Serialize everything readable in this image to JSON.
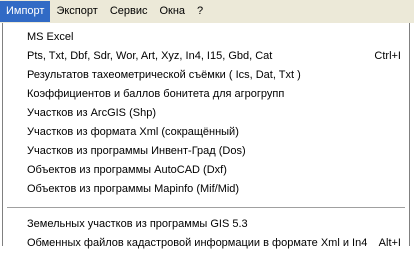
{
  "menubar": {
    "items": [
      {
        "label": "Импорт"
      },
      {
        "label": "Экспорт"
      },
      {
        "label": "Сервис"
      },
      {
        "label": "Окна"
      },
      {
        "label": "?"
      }
    ]
  },
  "dropdown": {
    "items": [
      {
        "label": "MS Excel",
        "shortcut": ""
      },
      {
        "label": "Pts, Txt, Dbf, Sdr, Wor, Art, Xyz, In4, I15, Gbd, Cat",
        "shortcut": "Ctrl+I"
      },
      {
        "label": "Результатов тахеометрической съёмки ( Ics, Dat, Txt )",
        "shortcut": ""
      },
      {
        "label": "Коэффициентов и баллов бонитета для агрогрупп",
        "shortcut": ""
      },
      {
        "label": "Участков из ArcGIS (Shp)",
        "shortcut": ""
      },
      {
        "label": "Участков из формата Xml (сокращённый)",
        "shortcut": ""
      },
      {
        "label": "Участков из программы Инвент-Град (Dos)",
        "shortcut": ""
      },
      {
        "label": "Объектов из программы AutoCAD (Dxf)",
        "shortcut": ""
      },
      {
        "label": "Объектов из программы Mapinfo (Mif/Mid)",
        "shortcut": ""
      }
    ],
    "items_after_separator": [
      {
        "label": "Земельных участков из программы GIS 5.3",
        "shortcut": ""
      },
      {
        "label": "Обменных файлов кадастровой информации в формате Xml и In4",
        "shortcut": "Alt+I"
      }
    ]
  }
}
